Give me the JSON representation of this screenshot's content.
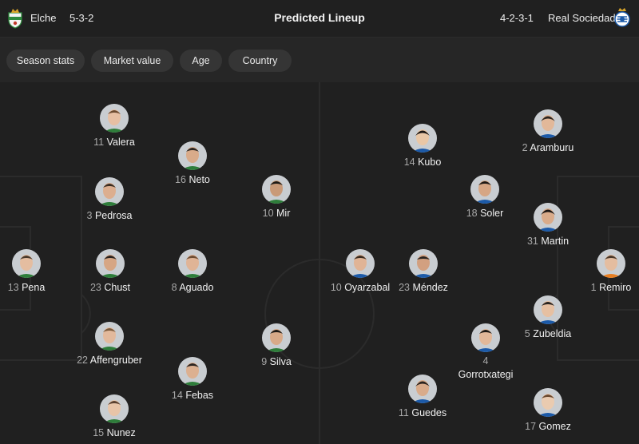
{
  "header": {
    "title": "Predicted Lineup",
    "home": {
      "name": "Elche",
      "formation": "5-3-2"
    },
    "away": {
      "name": "Real Sociedad",
      "formation": "4-2-3-1"
    }
  },
  "filters": [
    "Season stats",
    "Market value",
    "Age",
    "Country"
  ],
  "home_players": [
    {
      "num": "11",
      "name": "Valera"
    },
    {
      "num": "16",
      "name": "Neto"
    },
    {
      "num": "3",
      "name": "Pedrosa"
    },
    {
      "num": "10",
      "name": "Mir"
    },
    {
      "num": "13",
      "name": "Pena"
    },
    {
      "num": "23",
      "name": "Chust"
    },
    {
      "num": "8",
      "name": "Aguado"
    },
    {
      "num": "22",
      "name": "Affengruber"
    },
    {
      "num": "9",
      "name": "Silva"
    },
    {
      "num": "14",
      "name": "Febas"
    },
    {
      "num": "15",
      "name": "Nunez"
    }
  ],
  "away_players": [
    {
      "num": "14",
      "name": "Kubo"
    },
    {
      "num": "2",
      "name": "Aramburu"
    },
    {
      "num": "18",
      "name": "Soler"
    },
    {
      "num": "31",
      "name": "Martin"
    },
    {
      "num": "10",
      "name": "Oyarzabal"
    },
    {
      "num": "23",
      "name": "Méndez"
    },
    {
      "num": "1",
      "name": "Remiro"
    },
    {
      "num": "5",
      "name": "Zubeldia"
    },
    {
      "num": "4",
      "name": "Gorrotxategi"
    },
    {
      "num": "11",
      "name": "Guedes"
    },
    {
      "num": "17",
      "name": "Gomez"
    }
  ]
}
